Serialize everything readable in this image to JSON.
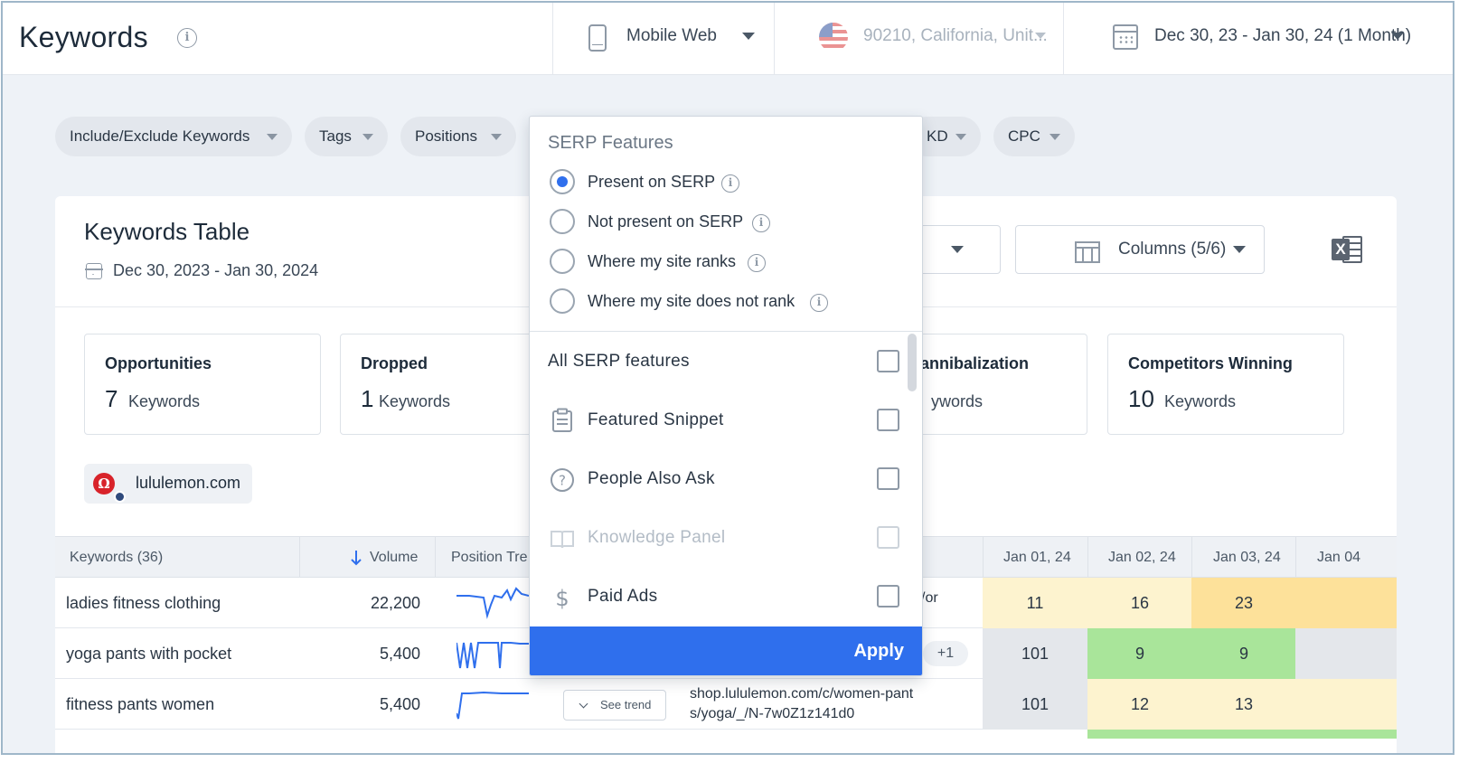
{
  "header": {
    "title": "Keywords",
    "device": "Mobile Web",
    "location": "90210, California, Unit...",
    "date_range": "Dec 30, 23 - Jan 30, 24 (1 Month)"
  },
  "filters": [
    {
      "label": "Include/Exclude Keywords"
    },
    {
      "label": "Tags"
    },
    {
      "label": "Positions"
    },
    {
      "label": "KD"
    },
    {
      "label": "CPC"
    }
  ],
  "card": {
    "title": "Keywords Table",
    "date": "Dec 30, 2023 - Jan 30, 2024",
    "columns_label": "Columns (5/6)"
  },
  "stats": [
    {
      "title": "Opportunities",
      "value": "7",
      "unit": "Keywords"
    },
    {
      "title": "Dropped",
      "value": "1",
      "unit": "Keywords"
    },
    {
      "title": "annibalization",
      "value": "",
      "unit": "ywords"
    },
    {
      "title": "Competitors Winning",
      "value": "10",
      "unit": "Keywords"
    }
  ],
  "domain": "lululemon.com",
  "table": {
    "headers": {
      "keywords": "Keywords (36)",
      "volume": "Volume",
      "trend": "Position Tre",
      "dates": [
        "Jan 01, 24",
        "Jan 02, 24",
        "Jan 03, 24",
        "Jan 04"
      ]
    },
    "rows": [
      {
        "keyword": "ladies fitness clothing",
        "volume": "22,200",
        "url_frag": "/or",
        "positions": [
          "11",
          "16",
          "23",
          ""
        ]
      },
      {
        "keyword": "yoga pants with pocket",
        "volume": "5,400",
        "extra": "+1",
        "positions": [
          "101",
          "9",
          "9",
          ""
        ]
      },
      {
        "keyword": "fitness pants women",
        "volume": "5,400",
        "trend_button": "See trend",
        "url_line1": "shop.lululemon.com/c/women-pant",
        "url_line2": "s/yoga/_/N-7w0Z1z141d0",
        "positions": [
          "101",
          "12",
          "13",
          ""
        ]
      }
    ]
  },
  "dropdown": {
    "title": "SERP Features",
    "radios": [
      {
        "label": "Present on SERP",
        "selected": true
      },
      {
        "label": "Not present on SERP",
        "selected": false
      },
      {
        "label": "Where my site ranks",
        "selected": false
      },
      {
        "label": "Where my site does not rank",
        "selected": false
      }
    ],
    "features": [
      {
        "label": "All SERP features",
        "icon": "none",
        "disabled": false
      },
      {
        "label": "Featured Snippet",
        "icon": "clipboard-icon",
        "disabled": false
      },
      {
        "label": "People Also Ask",
        "icon": "question-circle-icon",
        "disabled": false
      },
      {
        "label": "Knowledge Panel",
        "icon": "book-icon",
        "disabled": true
      },
      {
        "label": "Paid Ads",
        "icon": "dollar-icon",
        "disabled": false
      }
    ],
    "apply_label": "Apply"
  },
  "colors": {
    "accent": "#2f6fed",
    "pos_yellow": "#fdf3cf",
    "pos_orange": "#fde19a",
    "pos_green": "#a9e59a",
    "pos_gray": "#e4e7eb"
  }
}
